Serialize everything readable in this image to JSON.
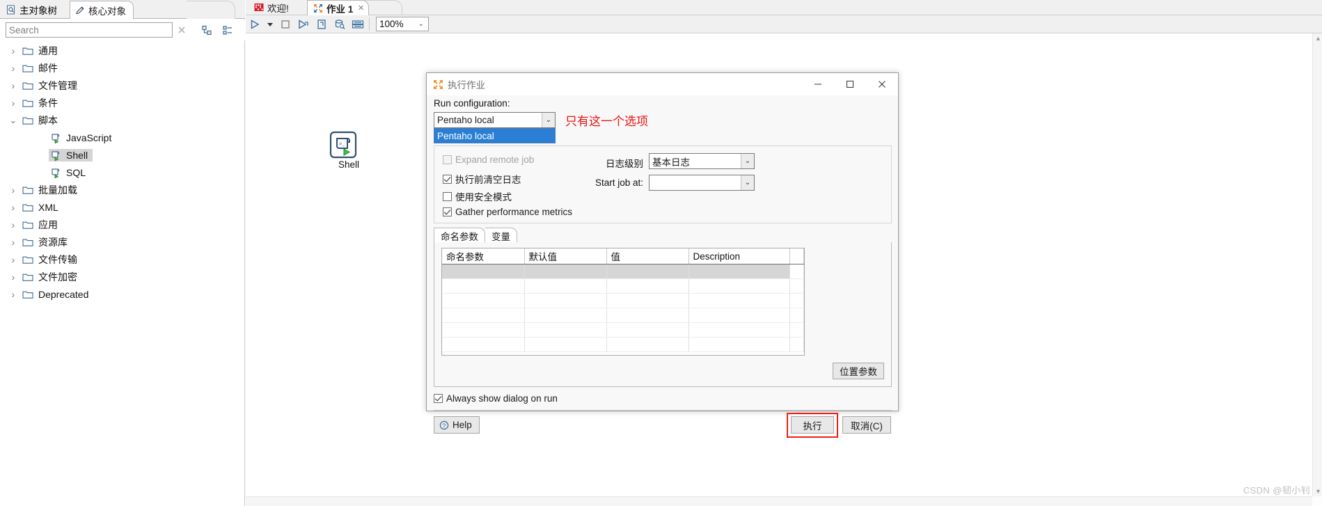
{
  "left_panel": {
    "tabs": [
      {
        "label": "主对象树",
        "icon": "document-tree-icon",
        "active": false
      },
      {
        "label": "核心对象",
        "icon": "pencil-icon",
        "active": true
      }
    ],
    "search": {
      "placeholder": "Search",
      "value": ""
    },
    "search_icons": [
      {
        "name": "clear-search-icon",
        "glyph": "✕"
      },
      {
        "name": "collapse-all-icon"
      },
      {
        "name": "expand-all-icon"
      }
    ],
    "tree": [
      {
        "label": "通用",
        "level": 1,
        "type": "folder",
        "expanded": false,
        "selected": false
      },
      {
        "label": "邮件",
        "level": 1,
        "type": "folder",
        "expanded": false,
        "selected": false
      },
      {
        "label": "文件管理",
        "level": 1,
        "type": "folder",
        "expanded": false,
        "selected": false
      },
      {
        "label": "条件",
        "level": 1,
        "type": "folder",
        "expanded": false,
        "selected": false
      },
      {
        "label": "脚本",
        "level": 1,
        "type": "folder",
        "expanded": true,
        "selected": false
      },
      {
        "label": "JavaScript",
        "level": 2,
        "type": "script",
        "expanded": null,
        "selected": false
      },
      {
        "label": "Shell",
        "level": 2,
        "type": "script",
        "expanded": null,
        "selected": true
      },
      {
        "label": "SQL",
        "level": 2,
        "type": "script",
        "expanded": null,
        "selected": false
      },
      {
        "label": "批量加载",
        "level": 1,
        "type": "folder",
        "expanded": false,
        "selected": false
      },
      {
        "label": "XML",
        "level": 1,
        "type": "folder",
        "expanded": false,
        "selected": false
      },
      {
        "label": "应用",
        "level": 1,
        "type": "folder",
        "expanded": false,
        "selected": false
      },
      {
        "label": "资源库",
        "level": 1,
        "type": "folder",
        "expanded": false,
        "selected": false
      },
      {
        "label": "文件传输",
        "level": 1,
        "type": "folder",
        "expanded": false,
        "selected": false
      },
      {
        "label": "文件加密",
        "level": 1,
        "type": "folder",
        "expanded": false,
        "selected": false
      },
      {
        "label": "Deprecated",
        "level": 1,
        "type": "folder",
        "expanded": false,
        "selected": false
      }
    ]
  },
  "editor": {
    "tabs": [
      {
        "label": "欢迎!",
        "icon": "welcome-icon",
        "active": false,
        "closable": false
      },
      {
        "label": "作业 1",
        "icon": "job-icon",
        "active": true,
        "closable": true,
        "close_glyph": "✕"
      }
    ],
    "toolbar": {
      "buttons": [
        {
          "name": "run-button",
          "icon": "play-triangle-icon"
        },
        {
          "name": "run-options-dropdown",
          "icon": "chevron-down-icon"
        },
        {
          "name": "stop-button",
          "icon": "stop-square-icon"
        },
        {
          "name": "preview-button",
          "icon": "play-step-icon"
        },
        {
          "name": "debug-button",
          "icon": "debug-icon"
        },
        {
          "name": "inspect-data-button",
          "icon": "database-search-icon"
        },
        {
          "name": "grid-view-button",
          "icon": "grid-icon"
        }
      ],
      "zoom": {
        "value": "100%",
        "chevron": "⌄"
      }
    },
    "canvas_nodes": [
      {
        "label": "Shell",
        "icon": "shell-script-icon"
      }
    ]
  },
  "dialog": {
    "title": "执行作业",
    "title_icon": "job-icon",
    "window_buttons": [
      {
        "name": "minimize-button",
        "glyph": "—"
      },
      {
        "name": "maximize-button",
        "glyph": "☐"
      },
      {
        "name": "close-button",
        "glyph": "✕"
      }
    ],
    "run_configuration": {
      "label": "Run configuration:",
      "value": "Pentaho local",
      "chevron": "⌄",
      "options": [
        "Pentaho local"
      ],
      "annotation": "只有这一个选项",
      "annotation_color": "#e8140f"
    },
    "options": {
      "expand_remote_job": {
        "label": "Expand remote job",
        "checked": false,
        "disabled": true
      },
      "clear_log_before_run": {
        "label": "执行前清空日志",
        "checked": true,
        "disabled": false
      },
      "safe_mode": {
        "label": "使用安全模式",
        "checked": false,
        "disabled": false
      },
      "gather_metrics": {
        "label": "Gather performance metrics",
        "checked": true,
        "disabled": false
      },
      "log_level": {
        "label": "日志级别",
        "value": "基本日志",
        "chevron": "⌄"
      },
      "start_job_at": {
        "label": "Start job at:",
        "value": "",
        "chevron": "⌄"
      }
    },
    "param_tabs": [
      {
        "label": "命名参数",
        "active": true
      },
      {
        "label": "变量",
        "active": false
      }
    ],
    "param_table": {
      "columns": [
        "命名参数",
        "默认值",
        "值",
        "Description"
      ],
      "rows": [
        [
          "",
          "",
          "",
          ""
        ],
        [
          "",
          "",
          "",
          ""
        ],
        [
          "",
          "",
          "",
          ""
        ],
        [
          "",
          "",
          "",
          ""
        ],
        [
          "",
          "",
          "",
          ""
        ],
        [
          "",
          "",
          "",
          ""
        ]
      ],
      "selected_row_index": 0
    },
    "positional_button": "位置参数",
    "always_show": {
      "label": "Always show dialog on run",
      "checked": true
    },
    "buttons": {
      "help": {
        "label": "Help",
        "icon": "question-circle-icon"
      },
      "execute": {
        "label": "执行",
        "highlighted": true,
        "highlight_color": "#f21d14"
      },
      "cancel": {
        "label": "取消(C)"
      }
    }
  },
  "watermark": "CSDN @韧小钊"
}
